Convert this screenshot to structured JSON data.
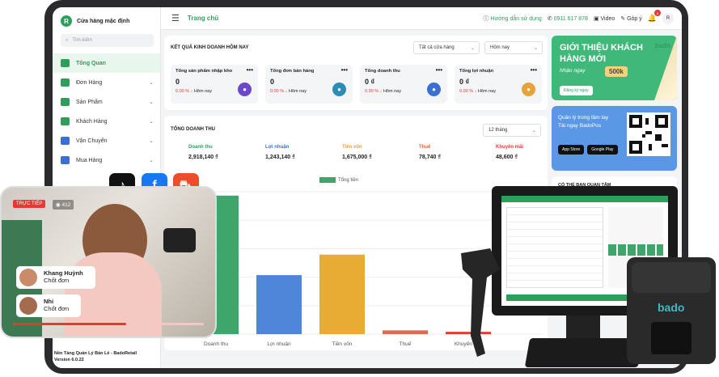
{
  "app": {
    "store_name": "Cửa hàng mặc định",
    "avatar_letter": "R",
    "search_placeholder": "Tìm kiếm",
    "footer_line1": "Nền Tảng Quản Lý Bán Lẻ - BadoRetail",
    "footer_line2": "Version 6.0.22"
  },
  "sidebar": {
    "items": [
      {
        "label": "Tổng Quan"
      },
      {
        "label": "Đơn Hàng"
      },
      {
        "label": "Sản Phẩm"
      },
      {
        "label": "Khách Hàng"
      },
      {
        "label": "Vận Chuyển"
      },
      {
        "label": "Mua Hàng"
      }
    ]
  },
  "topbar": {
    "crumb": "Trang chủ",
    "help": "Hướng dẫn sử dụng",
    "phone": "0911 617 878",
    "video": "Video",
    "feedback": "Góp ý",
    "bell_count": "8",
    "user_initial": "R"
  },
  "results": {
    "title": "KẾT QUẢ KINH DOANH HÔM NAY",
    "store_filter": "Tất cả cửa hàng",
    "date_filter": "Hôm nay",
    "stats": [
      {
        "title": "Tổng sản phẩm nhập kho",
        "value": "0",
        "pct": "0.00 %",
        "period": "Hôm nay",
        "color": "#6b48c8"
      },
      {
        "title": "Tổng đơn bán hàng",
        "value": "0",
        "pct": "0.00 %",
        "period": "Hôm nay",
        "color": "#2d8cb5"
      },
      {
        "title": "Tổng doanh thu",
        "value": "0 ₫",
        "pct": "0.00 %",
        "period": "Hôm nay",
        "color": "#3b6fd1"
      },
      {
        "title": "Tổng lợi nhuận",
        "value": "0 ₫",
        "pct": "0.00 %",
        "period": "Hôm nay",
        "color": "#e8a23a"
      }
    ]
  },
  "revenue": {
    "title": "TỔNG DOANH THU",
    "period": "12 tháng",
    "metrics": [
      {
        "label": "Doanh thu",
        "value": "2,918,140 ₫",
        "color": "#2e9e5b"
      },
      {
        "label": "Lợi nhuận",
        "value": "1,243,140 ₫",
        "color": "#3b6fd1"
      },
      {
        "label": "Tiền vốn",
        "value": "1,675,000 ₫",
        "color": "#e8a23a"
      },
      {
        "label": "Thuế",
        "value": "78,740 ₫",
        "color": "#d9643a"
      },
      {
        "label": "Khuyến mãi",
        "value": "48,600 ₫",
        "color": "#e53935"
      }
    ]
  },
  "chart_data": {
    "type": "bar",
    "categories": [
      "Doanh thu",
      "Lợi nhuận",
      "Tiền vốn",
      "Thuế",
      "Khuyến mãi"
    ],
    "series": [
      {
        "name": "Tổng tiền",
        "values": [
          2918140,
          1243140,
          1675000,
          78740,
          48600
        ]
      }
    ],
    "colors": [
      "#3ea66a",
      "#4f86d9",
      "#e8ab34",
      "#d96e4f",
      "#e53935"
    ],
    "ylim": [
      0,
      3000000
    ],
    "legend": "top"
  },
  "promo": {
    "title": "GIỚI THIỆU KHÁCH HÀNG MỚI",
    "subtitle": "Nhận ngay",
    "amount": "500k",
    "button": "Đăng ký ngay",
    "logo": "bado"
  },
  "qr": {
    "line1": "Quản lý trong tầm tay",
    "line2": "Tải ngay BadoPos",
    "app_store": "App Store",
    "google_play": "Google Play"
  },
  "care": {
    "title": "CÓ THỂ BẠN QUAN TÂM"
  },
  "live": {
    "tag": "TRỰC TIẾP",
    "views": "412",
    "comments": [
      {
        "name": "Khang Huỳnh",
        "text": "Chốt đơn"
      },
      {
        "name": "Nhi",
        "text": "Chốt đơn"
      }
    ]
  },
  "printer": {
    "brand": "bado"
  }
}
